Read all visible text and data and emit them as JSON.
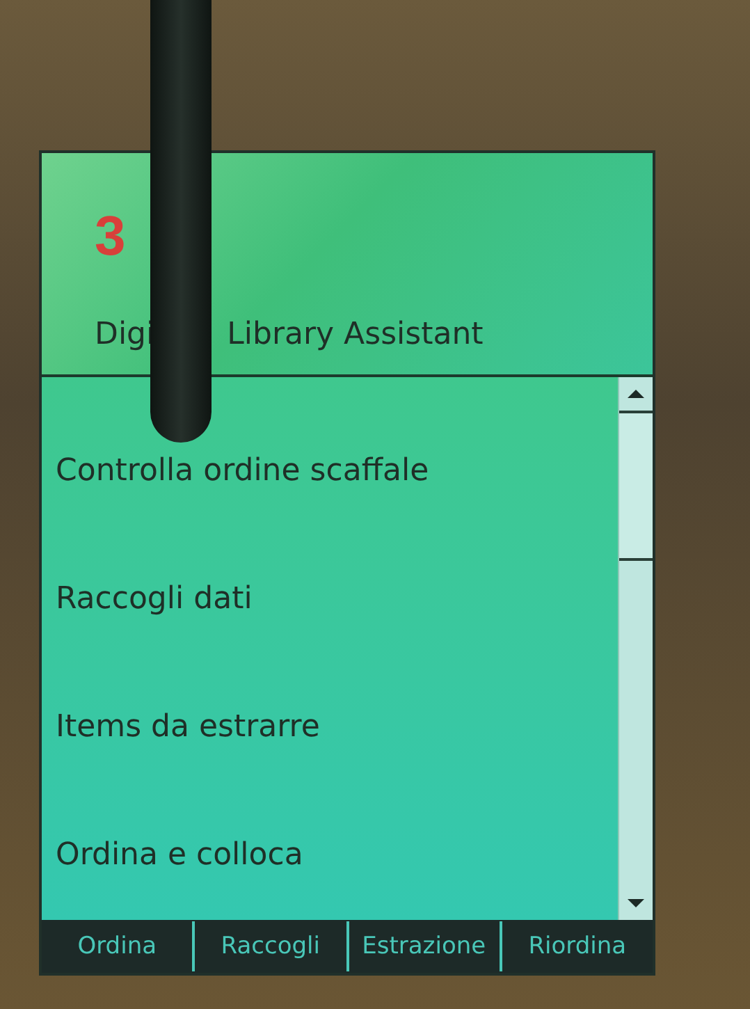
{
  "header": {
    "logo": "3",
    "title_parts": [
      "Digi",
      "Library Assistant"
    ]
  },
  "menu": {
    "items": [
      {
        "label": "Controlla ordine scaffale"
      },
      {
        "label": "Raccogli dati"
      },
      {
        "label": "Items da estrarre"
      },
      {
        "label": "Ordina e colloca"
      }
    ]
  },
  "tabs": [
    {
      "label": "Ordina"
    },
    {
      "label": "Raccogli"
    },
    {
      "label": "Estrazione"
    },
    {
      "label": "Riordina"
    }
  ]
}
